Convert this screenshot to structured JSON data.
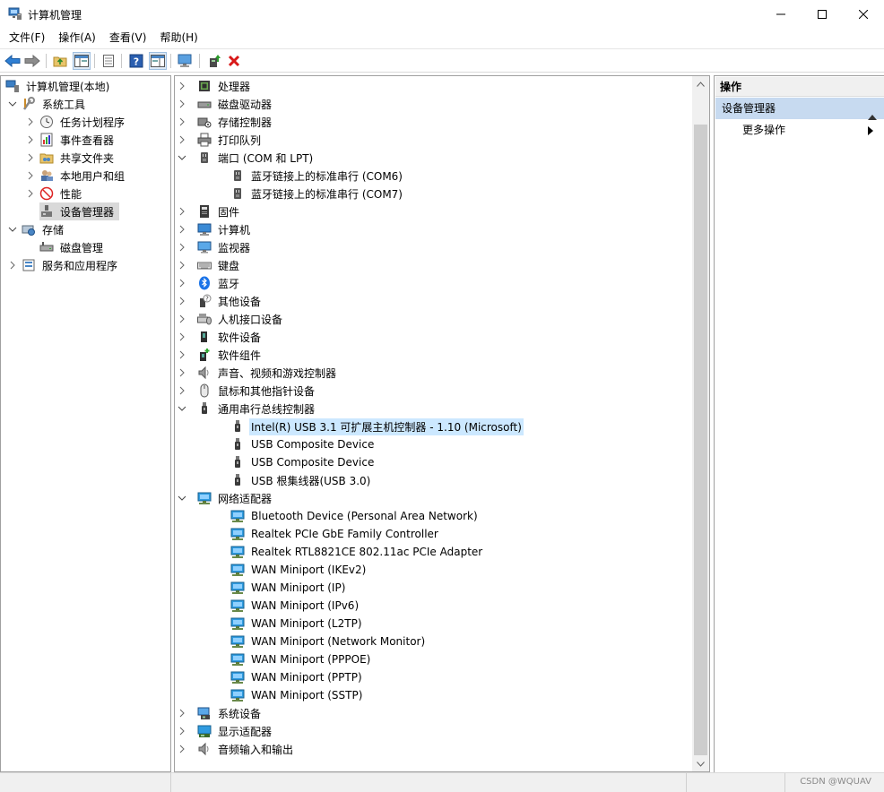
{
  "window": {
    "title": "计算机管理"
  },
  "menu": [
    "文件(F)",
    "操作(A)",
    "查看(V)",
    "帮助(H)"
  ],
  "left_tree": [
    {
      "label": "计算机管理(本地)",
      "icon": "computer-management-icon",
      "expanded": true
    },
    {
      "label": "系统工具",
      "icon": "system-tools-icon",
      "expanded": true
    },
    {
      "label": "任务计划程序",
      "icon": "task-scheduler-icon"
    },
    {
      "label": "事件查看器",
      "icon": "event-viewer-icon"
    },
    {
      "label": "共享文件夹",
      "icon": "shared-folders-icon"
    },
    {
      "label": "本地用户和组",
      "icon": "local-users-icon"
    },
    {
      "label": "性能",
      "icon": "performance-icon"
    },
    {
      "label": "设备管理器",
      "icon": "device-manager-icon",
      "selected": true
    },
    {
      "label": "存储",
      "icon": "storage-icon",
      "expanded": true
    },
    {
      "label": "磁盘管理",
      "icon": "disk-management-icon"
    },
    {
      "label": "服务和应用程序",
      "icon": "services-icon"
    }
  ],
  "device_tree": [
    {
      "label": "处理器",
      "icon": "processor-icon"
    },
    {
      "label": "磁盘驱动器",
      "icon": "disk-drive-icon"
    },
    {
      "label": "存储控制器",
      "icon": "storage-controller-icon"
    },
    {
      "label": "打印队列",
      "icon": "printer-icon"
    },
    {
      "label": "端口 (COM 和 LPT)",
      "icon": "port-icon",
      "expanded": true
    },
    {
      "label": "蓝牙链接上的标准串行 (COM6)",
      "icon": "port-icon"
    },
    {
      "label": "蓝牙链接上的标准串行 (COM7)",
      "icon": "port-icon"
    },
    {
      "label": "固件",
      "icon": "firmware-icon"
    },
    {
      "label": "计算机",
      "icon": "computer-icon"
    },
    {
      "label": "监视器",
      "icon": "monitor-icon"
    },
    {
      "label": "键盘",
      "icon": "keyboard-icon"
    },
    {
      "label": "蓝牙",
      "icon": "bluetooth-icon"
    },
    {
      "label": "其他设备",
      "icon": "other-devices-icon"
    },
    {
      "label": "人机接口设备",
      "icon": "hid-icon"
    },
    {
      "label": "软件设备",
      "icon": "software-device-icon"
    },
    {
      "label": "软件组件",
      "icon": "software-component-icon"
    },
    {
      "label": "声音、视频和游戏控制器",
      "icon": "sound-icon"
    },
    {
      "label": "鼠标和其他指针设备",
      "icon": "mouse-icon"
    },
    {
      "label": "通用串行总线控制器",
      "icon": "usb-icon",
      "expanded": true
    },
    {
      "label": "Intel(R) USB 3.1 可扩展主机控制器 - 1.10 (Microsoft)",
      "icon": "usb-icon",
      "selected": true
    },
    {
      "label": "USB Composite Device",
      "icon": "usb-icon"
    },
    {
      "label": "USB Composite Device",
      "icon": "usb-icon"
    },
    {
      "label": "USB 根集线器(USB 3.0)",
      "icon": "usb-icon"
    },
    {
      "label": "网络适配器",
      "icon": "network-adapter-icon",
      "expanded": true
    },
    {
      "label": "Bluetooth Device (Personal Area Network)",
      "icon": "network-adapter-icon"
    },
    {
      "label": "Realtek PCIe GbE Family Controller",
      "icon": "network-adapter-icon"
    },
    {
      "label": "Realtek RTL8821CE 802.11ac PCIe Adapter",
      "icon": "network-adapter-icon"
    },
    {
      "label": "WAN Miniport (IKEv2)",
      "icon": "network-adapter-icon"
    },
    {
      "label": "WAN Miniport (IP)",
      "icon": "network-adapter-icon"
    },
    {
      "label": "WAN Miniport (IPv6)",
      "icon": "network-adapter-icon"
    },
    {
      "label": "WAN Miniport (L2TP)",
      "icon": "network-adapter-icon"
    },
    {
      "label": "WAN Miniport (Network Monitor)",
      "icon": "network-adapter-icon"
    },
    {
      "label": "WAN Miniport (PPPOE)",
      "icon": "network-adapter-icon"
    },
    {
      "label": "WAN Miniport (PPTP)",
      "icon": "network-adapter-icon"
    },
    {
      "label": "WAN Miniport (SSTP)",
      "icon": "network-adapter-icon"
    },
    {
      "label": "系统设备",
      "icon": "system-device-icon"
    },
    {
      "label": "显示适配器",
      "icon": "display-adapter-icon"
    },
    {
      "label": "音频输入和输出",
      "icon": "audio-io-icon"
    }
  ],
  "actions": {
    "header": "操作",
    "section": "设备管理器",
    "item": "更多操作"
  },
  "watermark": "CSDN @WQUAV"
}
